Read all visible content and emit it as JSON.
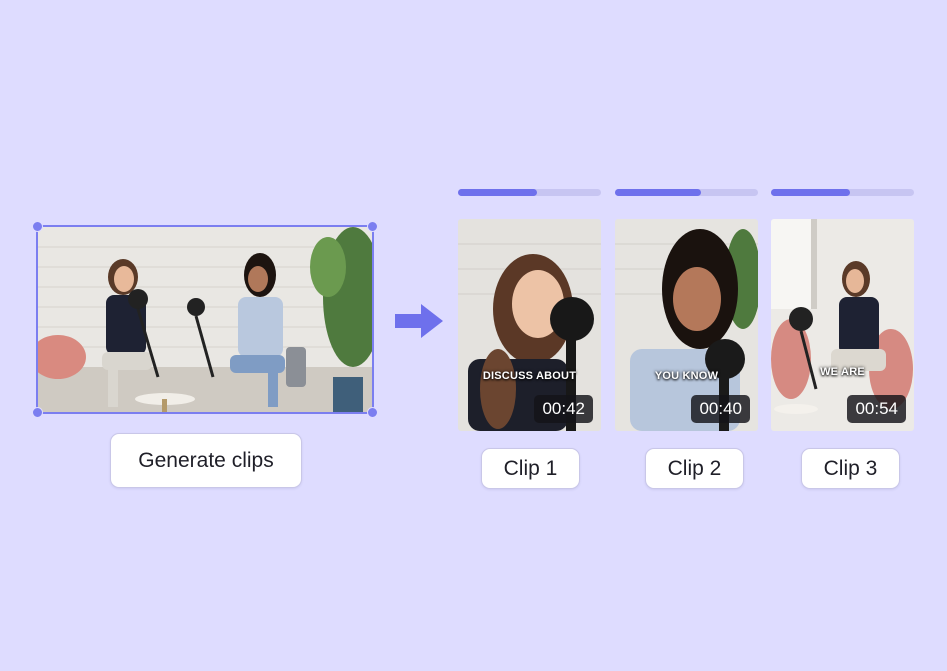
{
  "source": {
    "label": "source-video-frame"
  },
  "generate_button": {
    "label": "Generate clips"
  },
  "arrow": {
    "icon": "arrow-right-icon"
  },
  "colors": {
    "accent": "#6e70ec",
    "background": "#dedcff",
    "track": "#c7c5f2"
  },
  "clips": [
    {
      "caption": "DISCUSS ABOUT",
      "duration": "00:42",
      "label": "Clip 1",
      "progress": 0.55
    },
    {
      "caption": "YOU KNOW",
      "duration": "00:40",
      "label": "Clip 2",
      "progress": 0.6
    },
    {
      "caption": "WE ARE",
      "duration": "00:54",
      "label": "Clip 3",
      "progress": 0.55
    }
  ]
}
